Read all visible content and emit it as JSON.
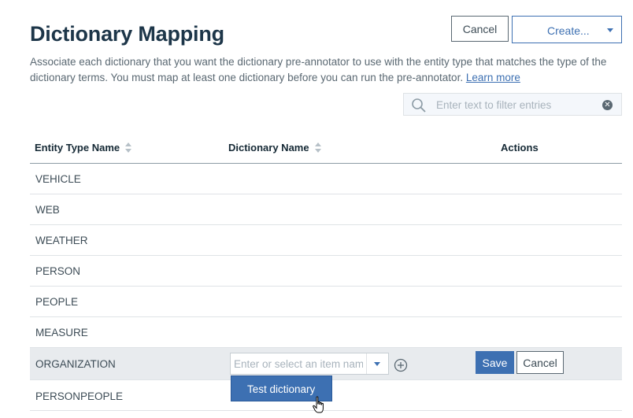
{
  "header": {
    "title": "Dictionary Mapping",
    "description": "Associate each dictionary that you want the dictionary pre-annotator to use with the entity type that matches the type of the dictionary terms. You must map at least one dictionary before you can run the pre-annotator.",
    "learn_more": "Learn more"
  },
  "toolbar": {
    "cancel_label": "Cancel",
    "create_label": "Create..."
  },
  "filter": {
    "placeholder": "Enter text to filter entries"
  },
  "table": {
    "columns": [
      "Entity Type Name",
      "Dictionary Name",
      "Actions"
    ],
    "rows": [
      "VEHICLE",
      "WEB",
      "WEATHER",
      "PERSON",
      "PEOPLE",
      "MEASURE",
      "ORGANIZATION",
      "PERSONPEOPLE"
    ]
  },
  "editor": {
    "placeholder": "Enter or select an item name",
    "save_label": "Save",
    "cancel_label": "Cancel",
    "options": [
      "Test dictionary"
    ]
  },
  "icons": {
    "filter": "search-icon",
    "clear": "clear-icon",
    "add": "add-circle-icon",
    "cursor": "hand-pointer-icon"
  },
  "colors": {
    "accent": "#3d70b2",
    "title": "#1d3649",
    "active_row": "#e8ebee"
  }
}
